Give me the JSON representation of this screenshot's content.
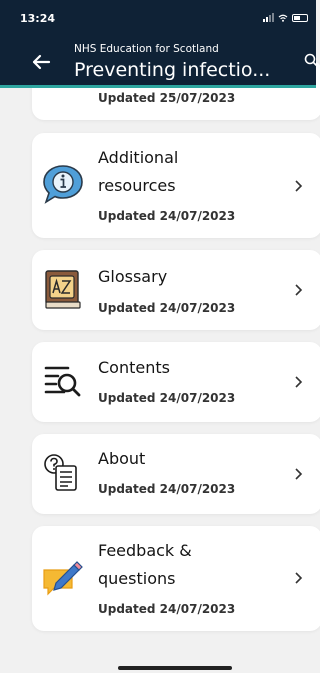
{
  "status_bar": {
    "time": "13:24"
  },
  "header": {
    "subtitle": "NHS Education for Scotland",
    "title": "Preventing infectio..."
  },
  "list": {
    "partial_card": {
      "updated": "Updated 25/07/2023"
    },
    "items": [
      {
        "title_line1": "Additional",
        "title_line2": "resources",
        "updated": "Updated 24/07/2023",
        "icon": "info-speech-bubble-icon"
      },
      {
        "title_line1": "Glossary",
        "updated": "Updated 24/07/2023",
        "icon": "glossary-book-icon"
      },
      {
        "title_line1": "Contents",
        "updated": "Updated 24/07/2023",
        "icon": "contents-search-icon"
      },
      {
        "title_line1": "About",
        "updated": "Updated 24/07/2023",
        "icon": "about-document-icon"
      },
      {
        "title_line1": "Feedback &",
        "title_line2": "questions",
        "updated": "Updated 24/07/2023",
        "icon": "feedback-pencil-icon"
      }
    ]
  },
  "colors": {
    "header_bg": "#0f2236",
    "accent": "#2ea6a0",
    "page_bg": "#f1f1f1",
    "card_bg": "#ffffff"
  }
}
